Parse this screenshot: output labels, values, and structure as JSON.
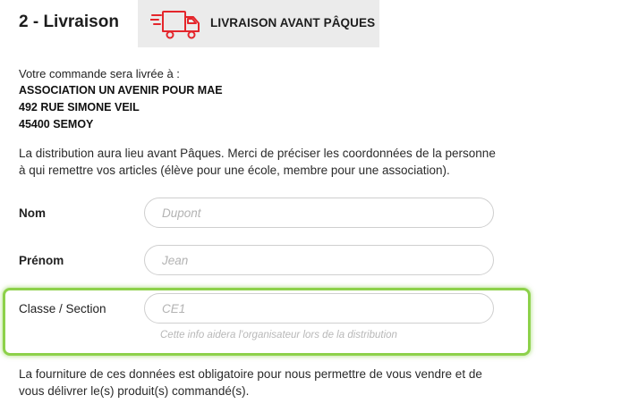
{
  "section": {
    "title": "2 - Livraison",
    "badge_label": "LIVRAISON AVANT PÂQUES",
    "accent_color": "#e4262c"
  },
  "address": {
    "intro": "Votre commande sera livrée à :",
    "line1": "ASSOCIATION UN AVENIR POUR MAE",
    "line2": "492 RUE SIMONE VEIL",
    "line3": "45400 SEMOY"
  },
  "info_top": {
    "line1": "La distribution aura lieu avant Pâques. Merci de préciser les coordonnées de la personne",
    "line2": "à qui remettre vos articles (élève pour une école, membre pour une association)."
  },
  "form": {
    "nom": {
      "label": "Nom",
      "value": "",
      "placeholder": "Dupont"
    },
    "prenom": {
      "label": "Prénom",
      "value": "",
      "placeholder": "Jean"
    },
    "classe": {
      "label": "Classe / Section",
      "value": "",
      "placeholder": "CE1",
      "helper": "Cette info aidera l'organisateur lors de la distribution",
      "highlight_color": "#8dd14a"
    }
  },
  "info_bottom": {
    "line1": "La fourniture de ces données est obligatoire pour nous permettre de vous vendre et de",
    "line2": "vous délivrer le(s) produit(s) commandé(s)."
  }
}
